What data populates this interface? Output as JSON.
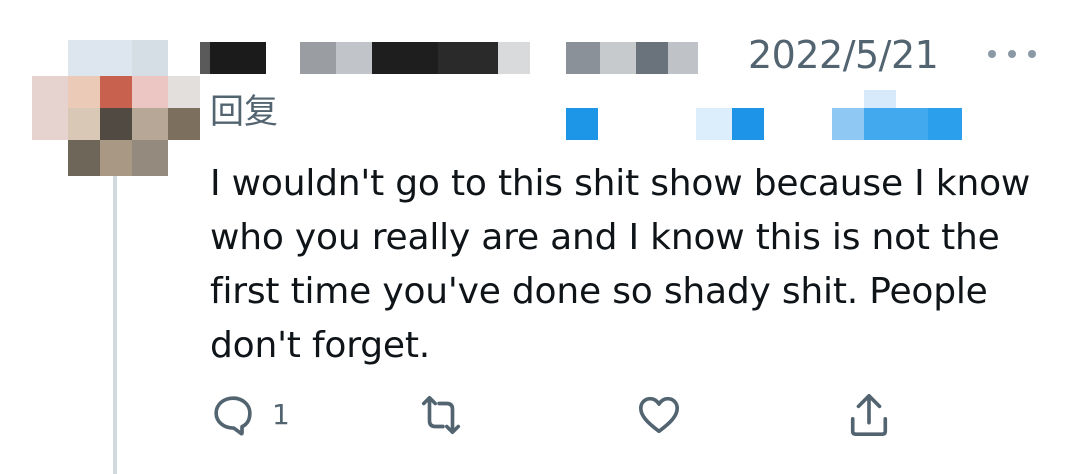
{
  "tweet": {
    "date": "2022/5/21",
    "reply_label": "回复",
    "text": "I wouldn't go to this shit show because I know who you really are and I know this is not the first time you've done so shady shit. People don't forget.",
    "reply_count": "1"
  },
  "icons": {
    "more": "more-horizontal-icon",
    "reply": "reply-icon",
    "retweet": "retweet-icon",
    "like": "heart-icon",
    "share": "share-icon"
  },
  "colors": {
    "text": "#0f1419",
    "secondary": "#536471",
    "icon": "#536471",
    "thread_line": "#cfd9de",
    "mention_blur": "#1d9bf0"
  }
}
